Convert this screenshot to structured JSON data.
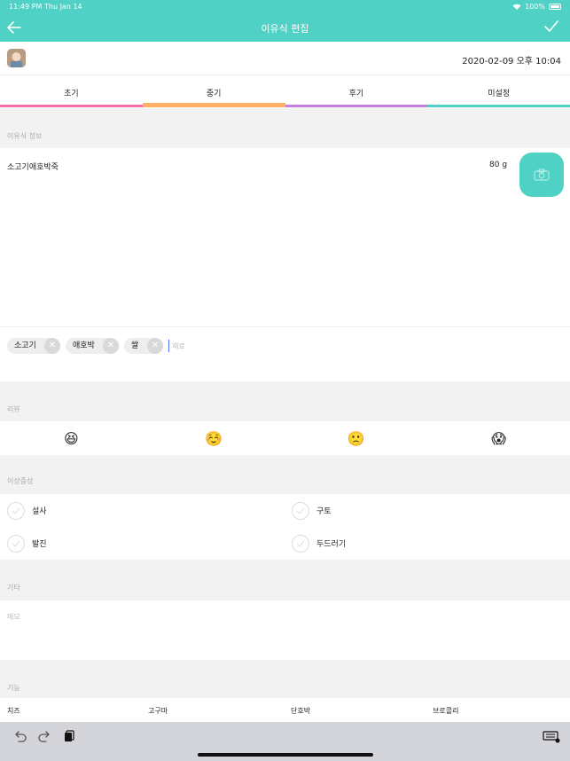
{
  "status_bar": {
    "time": "11:49 PM",
    "date": "Thu Jan 14",
    "battery": "100%"
  },
  "nav": {
    "title": "이유식 편집"
  },
  "meta": {
    "datetime": "2020-02-09  오후 10:04"
  },
  "tabs": [
    {
      "label": "초기",
      "color": "#f06fa9",
      "active": false
    },
    {
      "label": "중기",
      "color": "#ffb066",
      "active": true
    },
    {
      "label": "후기",
      "color": "#c87de0",
      "active": false
    },
    {
      "label": "미설정",
      "color": "#4fd1c5",
      "active": false
    }
  ],
  "food_info": {
    "section_label": "이유식 정보",
    "name": "소고기애호박죽",
    "amount": "80 g"
  },
  "ingredients": {
    "tags": [
      "소고기",
      "애호박",
      "쌀"
    ],
    "input_placeholder": "재료"
  },
  "review": {
    "section_label": "리뷰",
    "options": [
      "😆",
      "☺️",
      "🙁",
      "😱"
    ]
  },
  "symptoms": {
    "section_label": "이상증상",
    "items": [
      "설사",
      "구토",
      "발진",
      "두드러기"
    ]
  },
  "other": {
    "section_label": "기타",
    "memo_placeholder": "메모"
  },
  "favorites": {
    "section_label": "기능",
    "items": [
      "치즈",
      "고구마",
      "단호박",
      "브로콜리"
    ]
  },
  "colors": {
    "accent": "#4fd1c5"
  }
}
